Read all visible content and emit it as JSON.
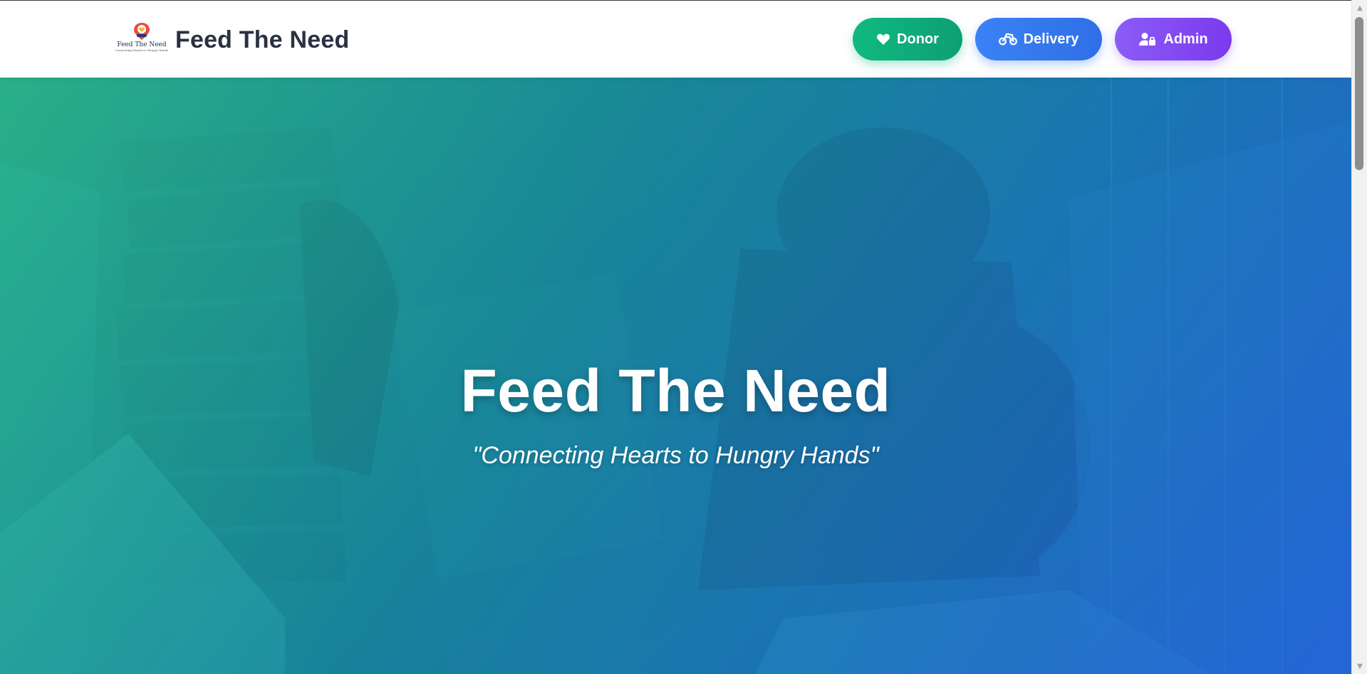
{
  "header": {
    "logo": {
      "icon": "location-heart-icon",
      "text": "Feed The Need",
      "tagline": "Connecting Hearts to Hungry Hands"
    },
    "title": "Feed The Need",
    "nav": {
      "donor": {
        "label": "Donor",
        "icon": "heart-icon",
        "color": "#10b981"
      },
      "delivery": {
        "label": "Delivery",
        "icon": "motorcycle-icon",
        "color": "#3b82f6"
      },
      "admin": {
        "label": "Admin",
        "icon": "user-lock-icon",
        "color": "#8b5cf6"
      }
    }
  },
  "hero": {
    "title": "Feed The Need",
    "quote": "\"Connecting Hearts to Hungry Hands\"",
    "gradient": [
      "#2fbf8c",
      "#1b7fb0",
      "#2a62d6"
    ]
  }
}
